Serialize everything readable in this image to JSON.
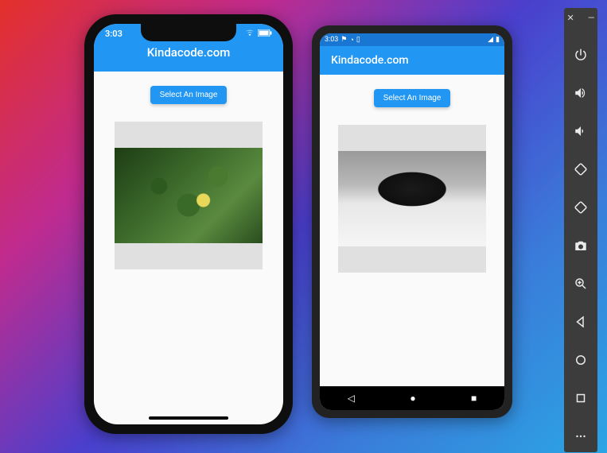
{
  "ios": {
    "status_time": "3:03",
    "wifi_icon": "wifi",
    "battery_icon": "battery",
    "app_title": "Kindacode.com",
    "button_label": "Select An Image",
    "image_desc": "green leaves plant photo"
  },
  "android": {
    "status_time": "3:03",
    "status_icons_left": [
      "debug",
      "clock",
      "sync",
      "circle"
    ],
    "status_icons_right": [
      "signal",
      "battery"
    ],
    "app_title": "Kindacode.com",
    "button_label": "Select An Image",
    "image_desc": "black dog lying on bed photo",
    "nav_back": "◁",
    "nav_home": "●",
    "nav_recent": "■"
  },
  "emulator_toolbar": {
    "close": "✕",
    "minimize": "—",
    "buttons": [
      "power-icon",
      "volume-up-icon",
      "volume-down-icon",
      "rotate-left-icon",
      "rotate-right-icon",
      "camera-icon",
      "zoom-in-icon",
      "back-icon",
      "home-circle-icon",
      "overview-icon",
      "more-icon"
    ]
  },
  "colors": {
    "primary": "#2196f3",
    "primary_dark": "#1976d2"
  }
}
